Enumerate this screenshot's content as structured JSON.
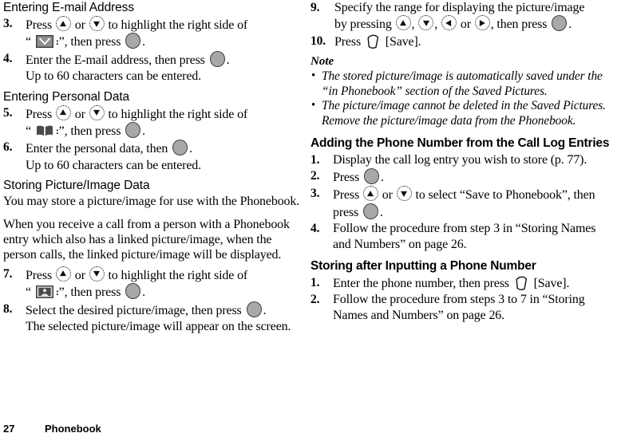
{
  "document": {
    "footer": {
      "page_number": "27",
      "section": "Phonebook"
    }
  },
  "left_column": {
    "heading_email": "Entering E-mail Address",
    "step3": {
      "num": "3.",
      "text_before": "Press",
      "or": "or",
      "text_after": "to highlight the right side of",
      "line2_open_quote": "“",
      "line2_close_quote": "”,",
      "line2_after": "then press",
      "period": ".",
      "icon": "envelope-icon"
    },
    "step4": {
      "num": "4.",
      "text": "Enter the E-mail address, then press",
      "period": "."
    },
    "step4_note": "Up to 60 characters can be entered.",
    "heading_personal": "Entering Personal Data",
    "step5": {
      "num": "5.",
      "text_before": "Press",
      "or": "or",
      "text_after": "to highlight the right side of",
      "line2_open_quote": "“",
      "line2_close_quote": "”,",
      "line2_after": "then press",
      "period": ".",
      "icon": "phonebook-icon"
    },
    "step6": {
      "num": "6.",
      "text": "Enter the personal data, then",
      "period": "."
    },
    "step6_note": "Up to 60 characters can be entered.",
    "heading_picture": "Storing Picture/Image Data",
    "para1": "You may store a picture/image for use with the Phonebook.",
    "para2": "When you receive a call from a person with a Phonebook entry which also has a linked picture/image, when the person calls, the linked picture/image will be displayed.",
    "step7": {
      "num": "7.",
      "text_before": "Press",
      "or": "or",
      "text_after": "to highlight the right side of",
      "line2_open_quote": "“",
      "line2_close_quote": "”,",
      "line2_after": "then press",
      "period": ".",
      "icon": "picture-icon"
    },
    "step8": {
      "num": "8.",
      "text": "Select the desired picture/image, then press",
      "period": "."
    },
    "step8_note": "The selected picture/image will appear on the screen."
  },
  "right_column": {
    "step9": {
      "num": "9.",
      "line1": "Specify the range for displaying the picture/image",
      "line2_before": "by pressing",
      "comma1": ",",
      "comma2": ",",
      "or": "or",
      "line2_after": ", then press",
      "period": "."
    },
    "step10": {
      "num": "10.",
      "text_before": "Press",
      "softkey_label": "[Save]."
    },
    "note_heading": "Note",
    "notes": [
      "The stored picture/image is automatically saved under the “in Phonebook” section of the Saved Pictures.",
      "The picture/image cannot be deleted in the Saved Pictures. Remove the picture/image data from the Phonebook."
    ],
    "heading_calllog": "Adding the Phone Number from the Call Log Entries",
    "cl_step1": {
      "num": "1.",
      "text": "Display the call log entry you wish to store (p. 77)."
    },
    "cl_step2": {
      "num": "2.",
      "text": "Press",
      "period": "."
    },
    "cl_step3": {
      "num": "3.",
      "text_before": "Press",
      "or": "or",
      "text_after": "to select “Save to Phonebook”, then",
      "line2": "press",
      "period": "."
    },
    "cl_step4": {
      "num": "4.",
      "text": "Follow the procedure from step 3 in “Storing Names and Numbers” on page 26."
    },
    "heading_inputting": "Storing after Inputting a Phone Number",
    "in_step1": {
      "num": "1.",
      "text_before": "Enter the phone number, then press",
      "softkey_label": "[Save]."
    },
    "in_step2": {
      "num": "2.",
      "text": "Follow the procedure from steps 3 to 7 in “Storing Names and Numbers” on page 26."
    }
  },
  "colors": {
    "text": "#000000",
    "key_fill": "#a8a8a8",
    "key_stroke": "#3a3a3a",
    "icon_gray": "#8a8a8a",
    "icon_dark": "#4a4a4a"
  }
}
